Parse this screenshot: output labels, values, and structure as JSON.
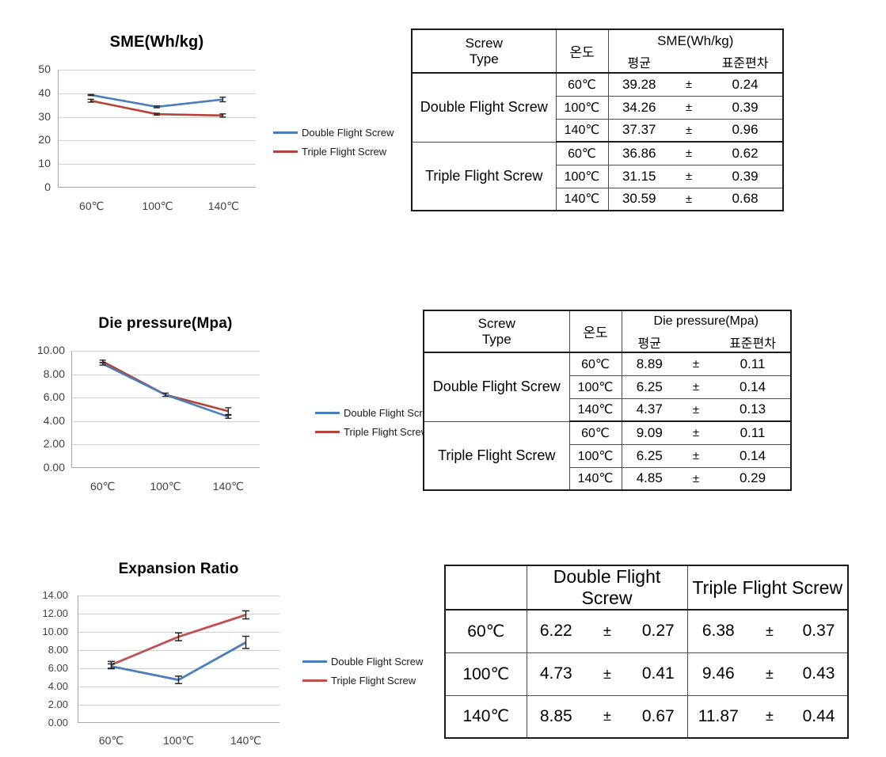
{
  "colors": {
    "double_blue": "#4a7ebb",
    "triple_red_1": "#b5433a",
    "triple_red_3": "#c0504d",
    "gridline": "#d2d2d2",
    "axis": "#a8a8a8",
    "table_border": "#4d4d4d",
    "table_border_heavy": "#1a1a1a"
  },
  "series_names": {
    "double": "Double Flight Screw",
    "triple": "Triple Flight Screw"
  },
  "common": {
    "header_screw_type_line1": "Screw",
    "header_screw_type_line2": "Type",
    "header_temp": "온도",
    "header_mean": "평균",
    "header_sd": "표준편차",
    "plus_minus": "±",
    "temps": [
      "60℃",
      "100℃",
      "140℃"
    ]
  },
  "charts": [
    {
      "id": "sme",
      "title": "SME(Wh/kg)",
      "chart_data": {
        "type": "line",
        "title": "SME(Wh/kg)",
        "xlabel": "",
        "ylabel": "",
        "categories": [
          "60℃",
          "100℃",
          "140℃"
        ],
        "ylim": [
          0,
          50
        ],
        "yticks": [
          "0",
          "10",
          "20",
          "30",
          "40",
          "50"
        ],
        "grid": true,
        "legend_position": "right",
        "series": [
          {
            "name": "Double Flight Screw",
            "color": "#4a7ebb",
            "values": [
              39.28,
              34.26,
              37.37
            ],
            "errors": [
              0.24,
              0.39,
              0.96
            ]
          },
          {
            "name": "Triple Flight Screw",
            "color": "#b5433a",
            "values": [
              36.86,
              31.15,
              30.59
            ],
            "errors": [
              0.62,
              0.39,
              0.68
            ]
          }
        ]
      }
    },
    {
      "id": "die",
      "title": "Die pressure(Mpa)",
      "chart_data": {
        "type": "line",
        "title": "Die pressure(Mpa)",
        "xlabel": "",
        "ylabel": "",
        "categories": [
          "60℃",
          "100℃",
          "140℃"
        ],
        "ylim": [
          0,
          10
        ],
        "yticks": [
          "0.00",
          "2.00",
          "4.00",
          "6.00",
          "8.00",
          "10.00"
        ],
        "grid": true,
        "legend_position": "right",
        "series": [
          {
            "name": "Double Flight Screw",
            "color": "#4a7ebb",
            "values": [
              8.89,
              6.25,
              4.37
            ],
            "errors": [
              0.11,
              0.14,
              0.13
            ]
          },
          {
            "name": "Triple Flight Screw",
            "color": "#b5433a",
            "values": [
              9.09,
              6.25,
              4.85
            ],
            "errors": [
              0.11,
              0.14,
              0.29
            ]
          }
        ]
      }
    },
    {
      "id": "expansion",
      "title": "Expansion Ratio",
      "chart_data": {
        "type": "line",
        "title": "Expansion Ratio",
        "xlabel": "",
        "ylabel": "",
        "categories": [
          "60℃",
          "100℃",
          "140℃"
        ],
        "ylim": [
          0,
          14
        ],
        "yticks": [
          "0.00",
          "2.00",
          "4.00",
          "6.00",
          "8.00",
          "10.00",
          "12.00",
          "14.00"
        ],
        "grid": true,
        "legend_position": "right",
        "series": [
          {
            "name": "Double Flight Screw",
            "color": "#4a7ebb",
            "values": [
              6.22,
              4.73,
              8.85
            ],
            "errors": [
              0.27,
              0.41,
              0.67
            ]
          },
          {
            "name": "Triple Flight Screw",
            "color": "#c0504d",
            "values": [
              6.38,
              9.46,
              11.87
            ],
            "errors": [
              0.37,
              0.43,
              0.44
            ]
          }
        ]
      }
    }
  ],
  "table1": {
    "header": {
      "screw_type_line1": "Screw",
      "screw_type_line2": "Type",
      "temp": "온도",
      "metric": "SME(Wh/kg)",
      "mean": "평균",
      "sd": "표준편차"
    },
    "groups": [
      {
        "name": "Double Flight Screw",
        "rows": [
          {
            "temp": "60℃",
            "mean": "39.28",
            "pm": "±",
            "sd": "0.24"
          },
          {
            "temp": "100℃",
            "mean": "34.26",
            "pm": "±",
            "sd": "0.39"
          },
          {
            "temp": "140℃",
            "mean": "37.37",
            "pm": "±",
            "sd": "0.96"
          }
        ]
      },
      {
        "name": "Triple Flight Screw",
        "rows": [
          {
            "temp": "60℃",
            "mean": "36.86",
            "pm": "±",
            "sd": "0.62"
          },
          {
            "temp": "100℃",
            "mean": "31.15",
            "pm": "±",
            "sd": "0.39"
          },
          {
            "temp": "140℃",
            "mean": "30.59",
            "pm": "±",
            "sd": "0.68"
          }
        ]
      }
    ]
  },
  "table2": {
    "header": {
      "screw_type_line1": "Screw",
      "screw_type_line2": "Type",
      "temp": "온도",
      "metric": "Die pressure(Mpa)",
      "mean": "평균",
      "sd": "표준편차"
    },
    "groups": [
      {
        "name": "Double Flight Screw",
        "rows": [
          {
            "temp": "60℃",
            "mean": "8.89",
            "pm": "±",
            "sd": "0.11"
          },
          {
            "temp": "100℃",
            "mean": "6.25",
            "pm": "±",
            "sd": "0.14"
          },
          {
            "temp": "140℃",
            "mean": "4.37",
            "pm": "±",
            "sd": "0.13"
          }
        ]
      },
      {
        "name": "Triple Flight Screw",
        "rows": [
          {
            "temp": "60℃",
            "mean": "9.09",
            "pm": "±",
            "sd": "0.11"
          },
          {
            "temp": "100℃",
            "mean": "6.25",
            "pm": "±",
            "sd": "0.14"
          },
          {
            "temp": "140℃",
            "mean": "4.85",
            "pm": "±",
            "sd": "0.29"
          }
        ]
      }
    ]
  },
  "table3": {
    "header": {
      "corner": "",
      "double": "Double Flight Screw",
      "triple": "Triple Flight Screw"
    },
    "rows": [
      {
        "temp": "60℃",
        "d_mean": "6.22",
        "d_pm": "±",
        "d_sd": "0.27",
        "t_mean": "6.38",
        "t_pm": "±",
        "t_sd": "0.37"
      },
      {
        "temp": "100℃",
        "d_mean": "4.73",
        "d_pm": "±",
        "d_sd": "0.41",
        "t_mean": "9.46",
        "t_pm": "±",
        "t_sd": "0.43"
      },
      {
        "temp": "140℃",
        "d_mean": "8.85",
        "d_pm": "±",
        "d_sd": "0.67",
        "t_mean": "11.87",
        "t_pm": "±",
        "t_sd": "0.44"
      }
    ]
  }
}
